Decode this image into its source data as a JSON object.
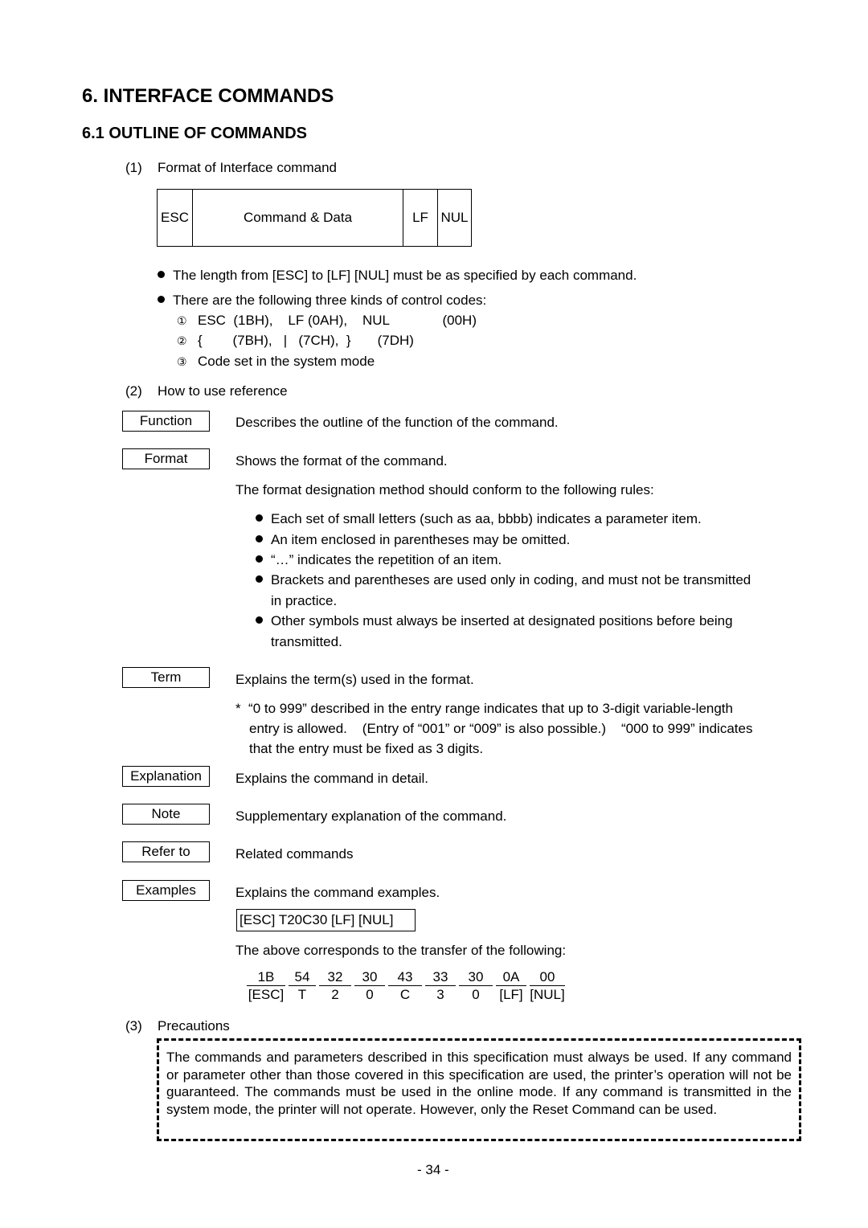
{
  "heading": "6.  INTERFACE COMMANDS",
  "subheading": "6.1  OUTLINE OF COMMANDS",
  "section1": {
    "number": "(1)",
    "title": "Format of Interface command",
    "format_cells": [
      "ESC",
      "Command & Data",
      "LF",
      "NUL"
    ],
    "bullets": [
      "The length from [ESC] to [LF] [NUL] must be as specified by each command.",
      "There are the following three kinds of control codes:"
    ],
    "codes": [
      {
        "marker": "①",
        "text": "ESC  (1BH),    LF (0AH),    NUL              (00H)"
      },
      {
        "marker": "②",
        "text": "{        (7BH),   |   (7CH),  }       (7DH)"
      },
      {
        "marker": "③",
        "text": "Code set in the system mode"
      }
    ]
  },
  "section2": {
    "number": "(2)",
    "title": "How to use reference",
    "function": {
      "label": "Function",
      "desc": "Describes the outline of the function of the command."
    },
    "format": {
      "label": "Format",
      "desc": "Shows the format of the command.",
      "rules_intro": "The format designation method should conform to the following rules:",
      "rules": [
        "Each set of small letters (such as aa, bbbb) indicates a parameter item.",
        "An item enclosed in parentheses may be omitted.",
        "“…” indicates the repetition of an item.",
        "Brackets and parentheses are used only in coding, and must not be transmitted",
        "Other symbols must always be inserted at designated positions before being"
      ],
      "rules_cont": [
        "in practice.",
        "transmitted."
      ]
    },
    "term": {
      "label": "Term",
      "desc": "Explains the term(s) used in the format.",
      "note_lines": [
        "*  “0 to 999” described in the entry range indicates that up to 3-digit variable-length",
        "entry is allowed.    (Entry of “001” or “009” is also possible.)    “000 to 999” indicates",
        "that the entry must be fixed as 3 digits."
      ]
    },
    "explanation": {
      "label": "Explanation",
      "desc": "Explains the command in detail."
    },
    "note": {
      "label": "Note",
      "desc": "Supplementary explanation of the command."
    },
    "refer_to": {
      "label": "Refer to",
      "desc": "Related commands"
    },
    "examples": {
      "label": "Examples",
      "desc": "Explains the command examples.",
      "example_cmd": "[ESC] T20C30 [LF] [NUL]",
      "transfer_intro": "The above corresponds to the transfer of the following:",
      "bytes": [
        {
          "hex": "1B",
          "char": "[ESC]"
        },
        {
          "hex": "54",
          "char": "T"
        },
        {
          "hex": "32",
          "char": "2"
        },
        {
          "hex": "30",
          "char": "0"
        },
        {
          "hex": "43",
          "char": "C"
        },
        {
          "hex": "33",
          "char": "3"
        },
        {
          "hex": "30",
          "char": "0"
        },
        {
          "hex": "0A",
          "char": "[LF]"
        },
        {
          "hex": "00",
          "char": "[NUL]"
        }
      ]
    }
  },
  "section3": {
    "number": "(3)",
    "title": "Precautions",
    "text": "The commands and parameters described in this specification must always be used.  If any command or parameter other than those covered in this specification are used, the printer’s operation will not be guaranteed.  The commands must be used in the online mode.  If any command is transmitted in the system mode, the printer will not operate.  However, only the Reset Command can be used."
  },
  "page_number": "- 34 -"
}
